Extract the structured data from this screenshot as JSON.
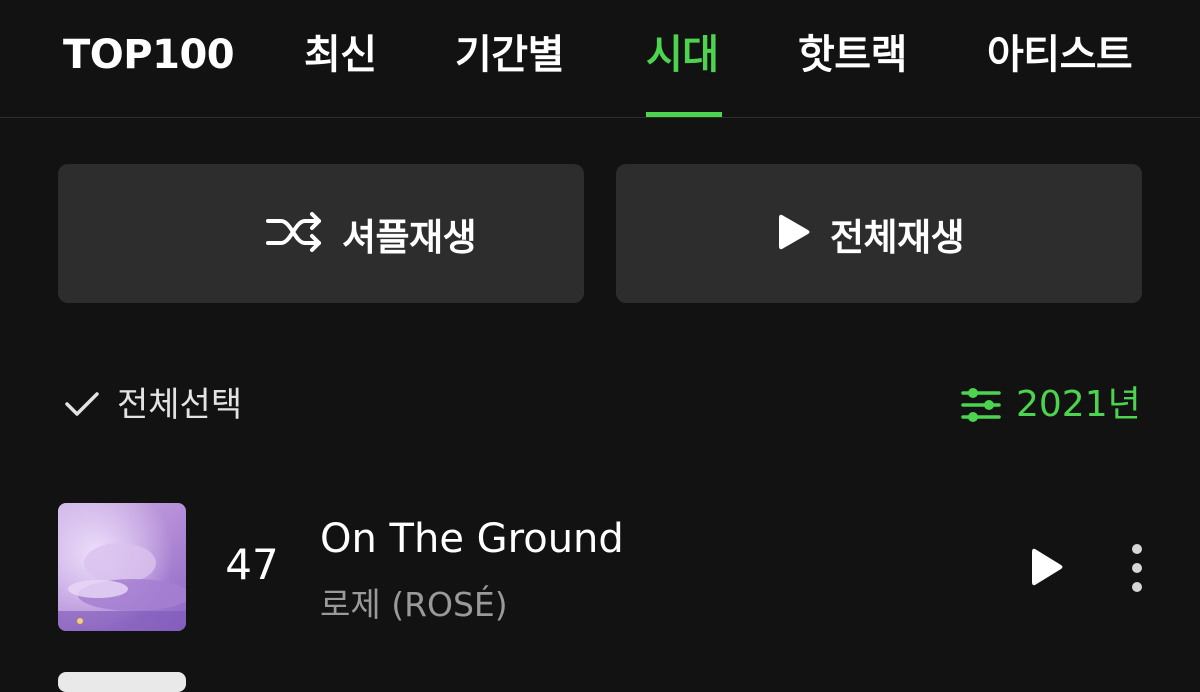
{
  "tabs": [
    {
      "label": "TOP100",
      "active": false
    },
    {
      "label": "최신",
      "active": false
    },
    {
      "label": "기간별",
      "active": false
    },
    {
      "label": "시대",
      "active": true
    },
    {
      "label": "핫트랙",
      "active": false
    },
    {
      "label": "아티스트",
      "active": false
    }
  ],
  "actions": {
    "shuffle_label": "셔플재생",
    "play_all_label": "전체재생",
    "shuffle_icon": "shuffle-icon",
    "play_icon": "play-icon"
  },
  "selection": {
    "select_all_label": "전체선택",
    "year_label": "2021년",
    "filter_icon": "sliders-icon"
  },
  "songs": [
    {
      "rank": "47",
      "title": "On The Ground",
      "artist": "로제 (ROSÉ)"
    }
  ],
  "colors": {
    "background": "#121212",
    "accent": "#4dd44e",
    "button_bg": "#2d2d2d",
    "secondary_text": "#9a9a9a"
  }
}
